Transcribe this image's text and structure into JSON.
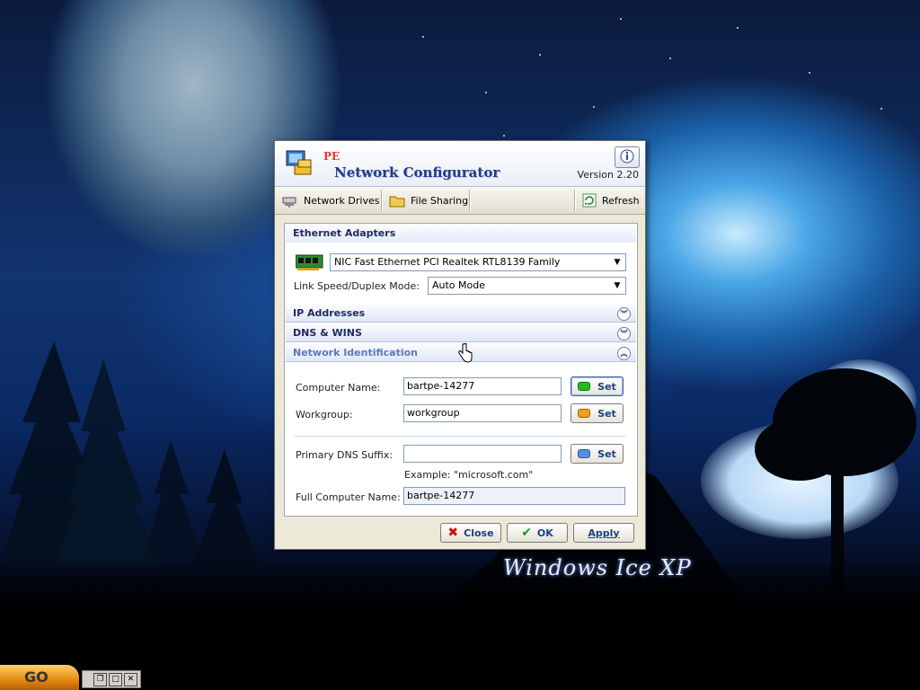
{
  "desktop": {
    "watermark": "Windows Ice XP"
  },
  "dialog": {
    "pe_label": "PE",
    "title": "Network Configurator",
    "version": "Version 2.20",
    "info_icon": "info-icon"
  },
  "toolbar": {
    "network_drives": "Network Drives",
    "file_sharing": "File Sharing",
    "refresh": "Refresh"
  },
  "ethernet": {
    "header": "Ethernet Adapters",
    "adapter": "NIC Fast Ethernet PCI Realtek RTL8139 Family",
    "link_label": "Link Speed/Duplex Mode:",
    "link_value": "Auto Mode"
  },
  "sections": {
    "ip": "IP Addresses",
    "dns": "DNS & WINS",
    "netid": "Network Identification"
  },
  "netid": {
    "computer_name_label": "Computer Name:",
    "computer_name": "bartpe-14277",
    "workgroup_label": "Workgroup:",
    "workgroup": "workgroup",
    "dns_suffix_label": "Primary DNS Suffix:",
    "dns_suffix": "",
    "example": "Example: \"microsoft.com\"",
    "full_name_label": "Full Computer Name:",
    "full_name": "bartpe-14277",
    "set_label": "Set",
    "led_colors": [
      "#22bb22",
      "#f0a020",
      "#5590e0"
    ]
  },
  "buttons": {
    "close": "Close",
    "ok": "OK",
    "apply": "Apply"
  },
  "taskbar": {
    "go": "GO"
  }
}
